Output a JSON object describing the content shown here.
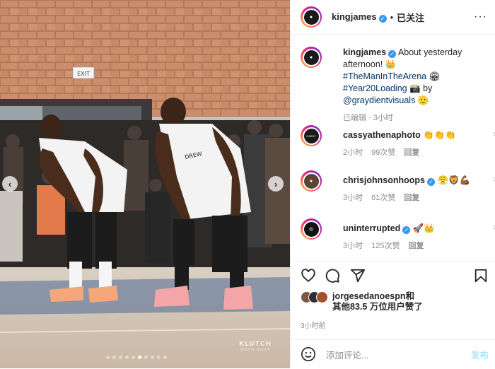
{
  "colors": {
    "accent": "#3897f0",
    "link": "#00376b",
    "muted": "#8e8e8e",
    "post_disabled": "#b2dffc"
  },
  "photo": {
    "exit_sign": "EXIT",
    "jersey_text": "DREW",
    "watermark": "KLUTCH",
    "watermark_sub": "SPORTS GROUP",
    "carousel_dots": 10,
    "carousel_active_index": 5
  },
  "header": {
    "username": "kingjames",
    "bullet": "•",
    "follow_label": "已关注",
    "more_label": "···"
  },
  "caption": {
    "username": "kingjames",
    "text_1": "About yesterday afternoon! 👑",
    "hashtag_1": "#TheManInTheArena",
    "text_2": "🏟",
    "hashtag_2": "#Year20Loading",
    "text_3": "📸 by",
    "mention": "@graydientvisuals",
    "text_4": "🫡",
    "meta_edited": "已编辑",
    "meta_time": "3小时"
  },
  "comments": [
    {
      "username": "cassyathenaphoto",
      "verified": false,
      "text": "👏👏👏",
      "time": "2小时",
      "likes": "99次赞",
      "reply": "回复",
      "avatar_label": "CASSY"
    },
    {
      "username": "chrisjohnsonhoops",
      "verified": true,
      "text": "😤🦁💪🏾",
      "time": "3小时",
      "likes": "61次赞",
      "reply": "回复",
      "avatar_label": ""
    },
    {
      "username": "uninterrupted",
      "verified": true,
      "text": "🚀👑",
      "time": "3小时",
      "likes": "125次赞",
      "reply": "回复",
      "avatar_label": ""
    }
  ],
  "actions": {
    "like_icon": "heart-icon",
    "comment_icon": "comment-icon",
    "share_icon": "share-icon",
    "save_icon": "bookmark-icon"
  },
  "likes": {
    "line_1": "jorgesedanoespn和",
    "line_2": "其他83.5 万位用户赞了"
  },
  "timestamp": "3小时前",
  "composer": {
    "placeholder": "添加评论...",
    "post_label": "发布"
  }
}
